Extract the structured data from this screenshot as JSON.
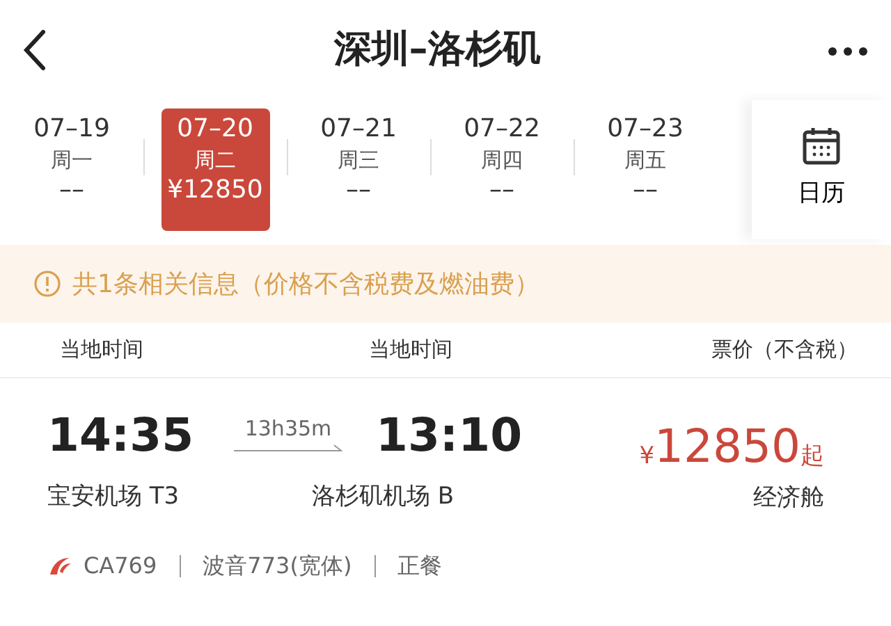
{
  "header": {
    "title": "深圳–洛杉矶"
  },
  "dates": [
    {
      "date": "07–19",
      "weekday": "周一",
      "price": "––",
      "selected": false
    },
    {
      "date": "07–20",
      "weekday": "周二",
      "price": "¥12850",
      "selected": true
    },
    {
      "date": "07–21",
      "weekday": "周三",
      "price": "––",
      "selected": false
    },
    {
      "date": "07–22",
      "weekday": "周四",
      "price": "––",
      "selected": false
    },
    {
      "date": "07–23",
      "weekday": "周五",
      "price": "––",
      "selected": false
    }
  ],
  "calendar": {
    "label": "日历"
  },
  "notice": "共1条相关信息（价格不含税费及燃油费）",
  "columns": [
    "当地时间",
    "当地时间",
    "票价（不含税）"
  ],
  "flight": {
    "depart_time": "14:35",
    "duration": "13h35m",
    "arrive_time": "13:10",
    "depart_airport": "宝安机场 T3",
    "arrive_airport": "洛杉矶机场 B",
    "price_currency": "¥",
    "price_amount": "12850",
    "price_suffix": "起",
    "cabin": "经济舱",
    "details": [
      "CA769",
      "波音773(宽体)",
      "正餐"
    ]
  }
}
